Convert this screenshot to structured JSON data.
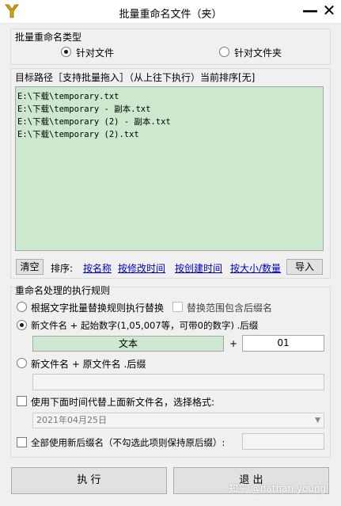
{
  "window": {
    "title": "批量重命名文件（夹）",
    "minimize_glyph": "—",
    "close_glyph": "✕"
  },
  "type_group": {
    "label": "批量重命名类型",
    "options": [
      {
        "label": "针对文件",
        "checked": true
      },
      {
        "label": "针对文件夹",
        "checked": false
      }
    ]
  },
  "path_group": {
    "label": "目标路径［支持批量拖入］（从上往下执行）当前排序[无]",
    "items": [
      "E:\\下载\\temporary.txt",
      "E:\\下载\\temporary - 副本.txt",
      "E:\\下载\\temporary (2) - 副本.txt",
      "E:\\下载\\temporary (2).txt"
    ],
    "clear_label": "清空",
    "sort_label": "排序:",
    "sort_links": [
      "按名称",
      "按修改时间",
      "按创建时间",
      "按大小/数量"
    ],
    "import_label": "导入"
  },
  "rule_group": {
    "label": "重命名处理的执行规则",
    "rule1_label": "根据文字批量替换规则执行替换",
    "rule1_ext_label": "替换范围包含后缀名",
    "rule2_label": "新文件名 + 起始数字(1,05,007等，可带0的数字) .后缀",
    "name_value": "文本",
    "plus": "+",
    "start_number": "01",
    "rule3_label": "新文件名 + 原文件名 .后缀",
    "time_label": "使用下面时间代替上面新文件名，选择格式:",
    "date_value": "2021年04月25日",
    "ext_label": "全部使用新后缀名（不勾选此项则保持原后缀）:"
  },
  "actions": {
    "execute_label": "执 行",
    "exit_label": "退 出"
  },
  "watermark": "知乎 @nathan.young"
}
